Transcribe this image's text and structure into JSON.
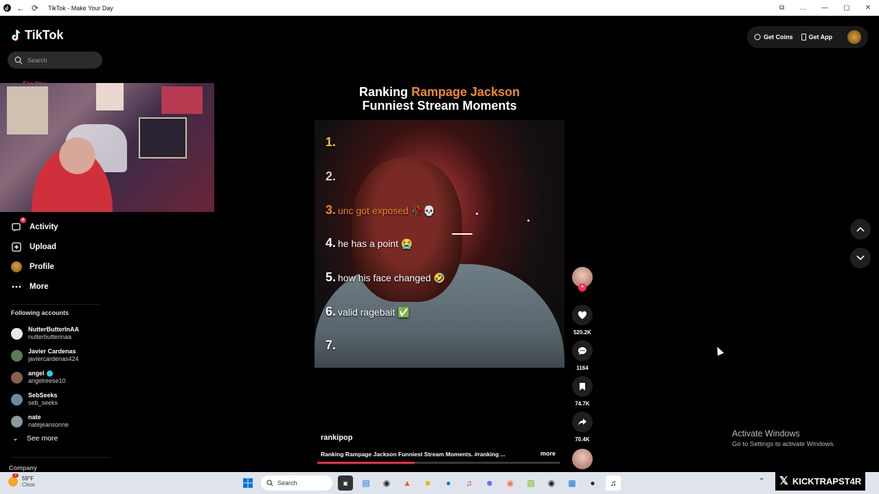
{
  "window": {
    "title": "TikTok - Make Your Day",
    "controls": [
      "⧉",
      "…",
      "—",
      "▢",
      "✕"
    ]
  },
  "app": {
    "logo_text": "TikTok",
    "search_placeholder": "Search",
    "hidden_nav_label": "For You",
    "nav": [
      {
        "label": "Activity",
        "icon": "message-icon",
        "badge": "4"
      },
      {
        "label": "Upload",
        "icon": "upload-icon"
      },
      {
        "label": "Profile",
        "icon": "profile-avatar"
      },
      {
        "label": "More",
        "icon": "more-icon"
      }
    ],
    "following_title": "Following accounts",
    "following": [
      {
        "name": "NutterButterInAA",
        "handle": "nutterbutterinaa",
        "verified": false
      },
      {
        "name": "Javier Cardenas",
        "handle": "javiercardenas424",
        "verified": false
      },
      {
        "name": "angel",
        "handle": "angelreese10",
        "verified": true
      },
      {
        "name": "SebSeeks",
        "handle": "seb_seeks",
        "verified": false
      },
      {
        "name": "nate",
        "handle": "natejeansonne",
        "verified": false
      }
    ],
    "see_more": "See more",
    "company": "Company",
    "topbar": {
      "get_coins": "Get Coins",
      "get_app": "Get App"
    }
  },
  "video": {
    "title_part1": "Ranking ",
    "title_orange": "Rampage Jackson",
    "title_line2": "Funniest Stream Moments",
    "rankings": [
      {
        "n": "1.",
        "text": "",
        "color": "#f0c43a"
      },
      {
        "n": "2.",
        "text": "",
        "color": "#cfcfcf"
      },
      {
        "n": "3.",
        "text": "unc got exposed 🥀💀",
        "color": "#f08a24"
      },
      {
        "n": "4.",
        "text": "he has a point 😭",
        "color": "#ffffff"
      },
      {
        "n": "5.",
        "text": "how his face changed 🤣",
        "color": "#ffffff"
      },
      {
        "n": "6.",
        "text": "valid ragebait ✅",
        "color": "#ffffff"
      },
      {
        "n": "7.",
        "text": "",
        "color": "#ffffff"
      }
    ],
    "likes": "520.2K",
    "comments": "1164",
    "saves": "74.7K",
    "shares": "70.4K",
    "author": "rankipop",
    "caption": "Ranking Rampage Jackson Funniest Stream Moments. #ranking ...",
    "more": "more",
    "progress": 0.4
  },
  "activation": {
    "line1": "Activate Windows",
    "line2": "Go to Settings to activate Windows."
  },
  "taskbar": {
    "temp": "59°F",
    "condition": "Clear",
    "weather_badge": "2",
    "search": "Search"
  },
  "watermark": "KICKTRAPST4R",
  "colors": {
    "accent": "#fe2c55",
    "orange": "#f08a24"
  }
}
